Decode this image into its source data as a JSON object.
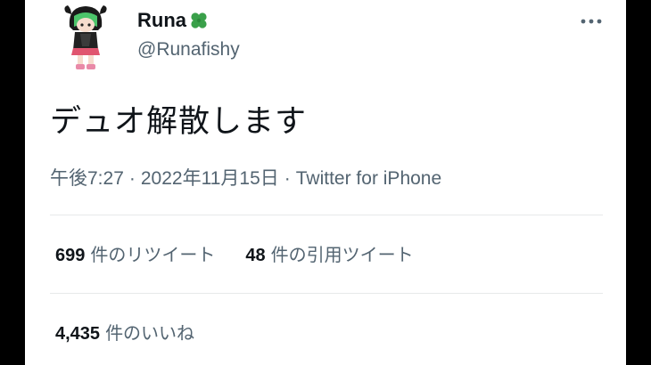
{
  "author": {
    "display_name": "Runa",
    "handle": "@Runafishy"
  },
  "icons": {
    "name_emoji": "four-leaf-clover-icon",
    "menu": "more-dots-icon"
  },
  "tweet": {
    "text": "デュオ解散します",
    "time": "午後7:27",
    "date": "2022年11月15日",
    "source": "Twitter for iPhone",
    "separator": "·"
  },
  "stats": {
    "retweets_count": "699",
    "retweets_label": "件のリツイート",
    "quotes_count": "48",
    "quotes_label": "件の引用ツイート",
    "likes_count": "4,435",
    "likes_label": "件のいいね"
  },
  "colors": {
    "primary_text": "#0f1419",
    "secondary_text": "#536471",
    "divider": "#e7e9ea",
    "clover": "#3aa04a",
    "letterbox": "#000000"
  }
}
